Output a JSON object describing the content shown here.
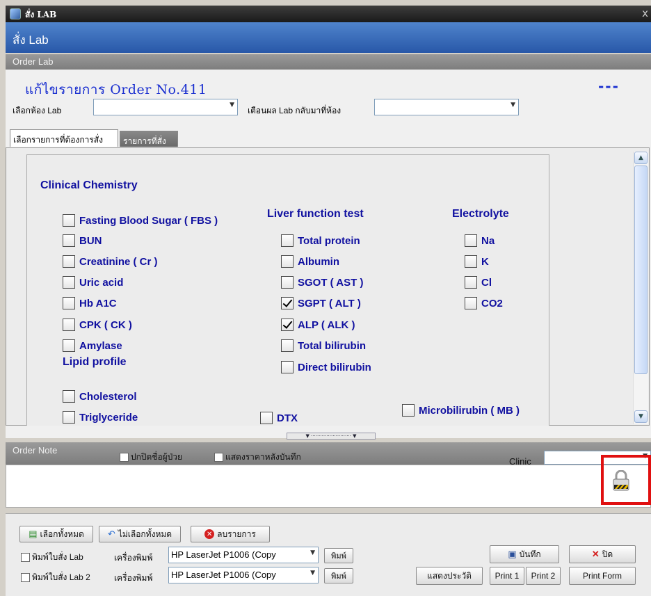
{
  "window": {
    "title": "สั่ง LAB",
    "close_glyph": "x"
  },
  "header": {
    "title": "สั่ง Lab",
    "subtitle": "Order Lab"
  },
  "order": {
    "title": "แก้ไขรายการ Order No.411",
    "status": "---"
  },
  "fields": {
    "lab_room_label": "เลือกห้อง Lab",
    "lab_room_value": "",
    "notify_label": "เตือนผล Lab กลับมาที่ห้อง",
    "notify_value": ""
  },
  "tabs": [
    {
      "label": "เลือกรายการที่ต้องการสั่ง",
      "active": true
    },
    {
      "label": "รายการที่สั่ง",
      "active": false
    }
  ],
  "sections": {
    "clinical_chemistry": "Clinical Chemistry",
    "liver_function": "Liver function test",
    "electrolyte": "Electrolyte",
    "lipid_profile": "Lipid profile"
  },
  "tests": {
    "fbs": {
      "label": "Fasting Blood Sugar ( FBS )",
      "checked": false
    },
    "bun": {
      "label": "BUN",
      "checked": false
    },
    "cr": {
      "label": "Creatinine ( Cr )",
      "checked": false
    },
    "uric": {
      "label": "Uric acid",
      "checked": false
    },
    "hba1c": {
      "label": "Hb A1C",
      "checked": false
    },
    "cpk": {
      "label": "CPK ( CK )",
      "checked": false
    },
    "amylase": {
      "label": "Amylase",
      "checked": false
    },
    "total_protein": {
      "label": "Total protein",
      "checked": false
    },
    "albumin": {
      "label": "Albumin",
      "checked": false
    },
    "sgot": {
      "label": "SGOT ( AST )",
      "checked": false
    },
    "sgpt": {
      "label": "SGPT ( ALT )",
      "checked": true
    },
    "alp": {
      "label": "ALP ( ALK )",
      "checked": true
    },
    "total_bili": {
      "label": "Total bilirubin",
      "checked": false
    },
    "direct_bili": {
      "label": "Direct bilirubin",
      "checked": false
    },
    "na": {
      "label": "Na",
      "checked": false
    },
    "k": {
      "label": "K",
      "checked": false
    },
    "cl": {
      "label": "Cl",
      "checked": false
    },
    "co2": {
      "label": "CO2",
      "checked": false
    },
    "cholesterol": {
      "label": "Cholesterol",
      "checked": false
    },
    "triglyceride": {
      "label": "Triglyceride",
      "checked": false
    },
    "dtx": {
      "label": "DTX",
      "checked": false
    },
    "mb": {
      "label": "Microbilirubin ( MB )",
      "checked": false
    }
  },
  "note": {
    "title": "Order Note",
    "hide_name": "ปกปิดชื่อผู้ป่วย",
    "show_price": "แสดงราคาหลังบันทึก",
    "clinic_label": "Clinic",
    "clinic_value": "",
    "text": ""
  },
  "actions": {
    "select_all": "เลือกทั้งหมด",
    "deselect_all": "ไม่เลือกทั้งหมด",
    "delete": "ลบรายการ",
    "print_lab": "พิมพ์ใบสั่ง Lab",
    "print_lab2": "พิมพ์ใบสั่ง Lab 2",
    "printer_label": "เครื่องพิมพ์",
    "printer1": "HP LaserJet P1006 (Copy",
    "printer2": "HP LaserJet P1006 (Copy",
    "print": "พิมพ์",
    "history": "แสดงประวัติ",
    "save": "บันทึก",
    "close": "ปิด",
    "print1": "Print 1",
    "print2": "Print 2",
    "print_form": "Print Form"
  },
  "colors": {
    "accent": "#1010a0",
    "header_blue": "#2f62b3",
    "highlight": "#e01010"
  }
}
